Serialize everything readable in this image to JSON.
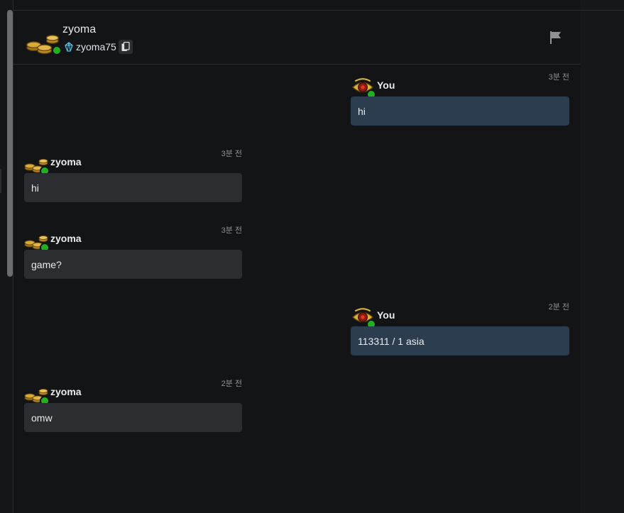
{
  "colors": {
    "background": "#131416",
    "outgoing_bubble": "#2c3d4f",
    "incoming_bubble": "#2c2d30",
    "online_status": "#21b021",
    "timestamp": "#8e9094"
  },
  "header": {
    "name": "zyoma",
    "tag": "zyoma75",
    "tag_icon": "crystal-icon",
    "copy_icon": "copy-icon",
    "report_icon": "flag-icon"
  },
  "messages": [
    {
      "sender": "You",
      "time": "3분 전",
      "text": "hi",
      "direction": "outgoing",
      "avatar": "golden-eye-icon"
    },
    {
      "sender": "zyoma",
      "time": "3분 전",
      "text": "hi",
      "direction": "incoming",
      "avatar": "gold-coins-icon"
    },
    {
      "sender": "zyoma",
      "time": "3분 전",
      "text": "game?",
      "direction": "incoming",
      "avatar": "gold-coins-icon"
    },
    {
      "sender": "You",
      "time": "2분 전",
      "text": "113311 / 1 asia",
      "direction": "outgoing",
      "avatar": "golden-eye-icon"
    },
    {
      "sender": "zyoma",
      "time": "2분 전",
      "text": "omw",
      "direction": "incoming",
      "avatar": "gold-coins-icon"
    }
  ]
}
